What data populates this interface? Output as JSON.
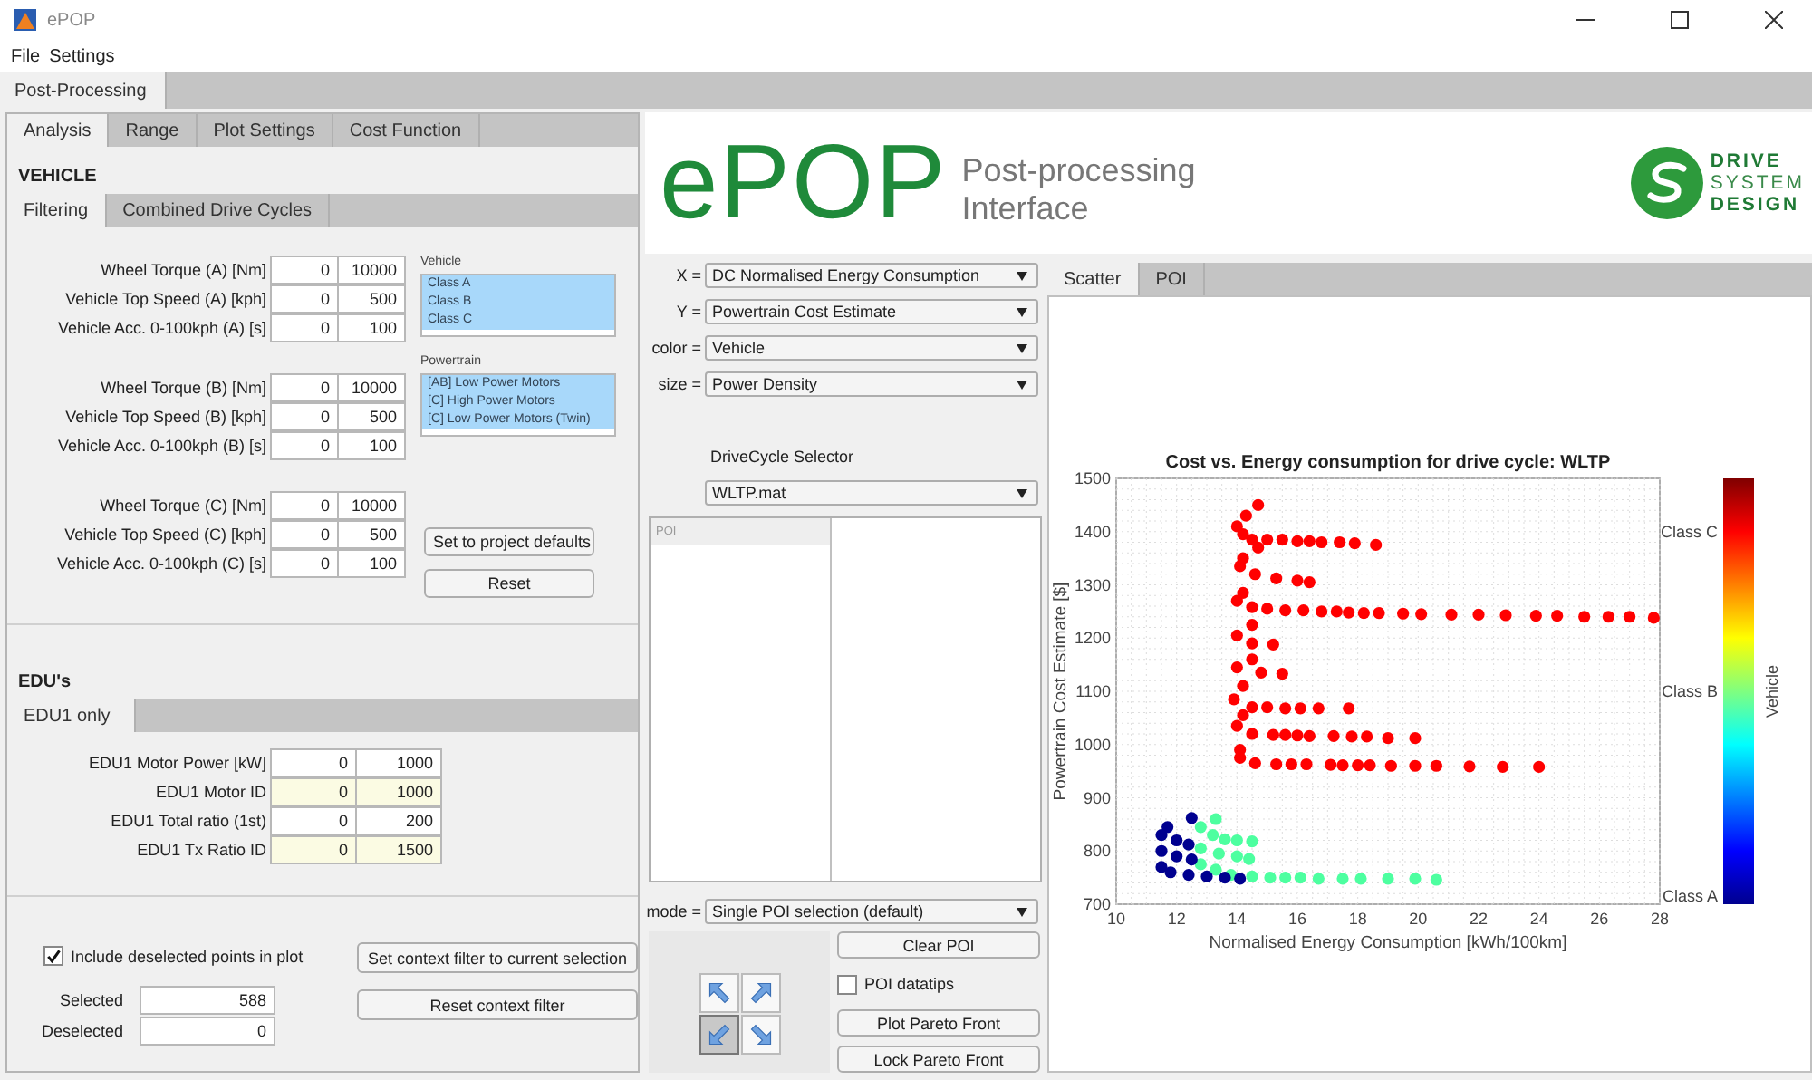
{
  "window": {
    "title": "ePOP"
  },
  "menu": [
    "File",
    "Settings"
  ],
  "main_tabs": [
    {
      "label": "Post-Processing",
      "selected": true
    }
  ],
  "left_tabs": [
    {
      "label": "Analysis",
      "selected": true
    },
    {
      "label": "Range",
      "selected": false
    },
    {
      "label": "Plot Settings",
      "selected": false
    },
    {
      "label": "Cost Function",
      "selected": false
    }
  ],
  "vehicle": {
    "heading": "VEHICLE",
    "tabs": [
      {
        "label": "Filtering",
        "selected": true
      },
      {
        "label": "Combined Drive Cycles",
        "selected": false
      }
    ],
    "filter_groups": [
      [
        {
          "label": "Wheel Torque (A) [Nm]",
          "min": "0",
          "max": "10000"
        },
        {
          "label": "Vehicle Top Speed (A) [kph]",
          "min": "0",
          "max": "500"
        },
        {
          "label": "Vehicle Acc. 0-100kph (A) [s]",
          "min": "0",
          "max": "100"
        }
      ],
      [
        {
          "label": "Wheel Torque (B) [Nm]",
          "min": "0",
          "max": "10000"
        },
        {
          "label": "Vehicle Top Speed (B) [kph]",
          "min": "0",
          "max": "500"
        },
        {
          "label": "Vehicle Acc. 0-100kph (B) [s]",
          "min": "0",
          "max": "100"
        }
      ],
      [
        {
          "label": "Wheel Torque (C) [Nm]",
          "min": "0",
          "max": "10000"
        },
        {
          "label": "Vehicle Top Speed (C) [kph]",
          "min": "0",
          "max": "500"
        },
        {
          "label": "Vehicle Acc. 0-100kph (C) [s]",
          "min": "0",
          "max": "100"
        }
      ]
    ],
    "lists": [
      {
        "label": "Vehicle",
        "items": [
          {
            "text": "Class A",
            "selected": true
          },
          {
            "text": "Class B",
            "selected": true
          },
          {
            "text": "Class C",
            "selected": true
          }
        ]
      },
      {
        "label": "Powertrain",
        "items": [
          {
            "text": "[AB] Low Power Motors",
            "selected": true
          },
          {
            "text": "[C] High Power Motors",
            "selected": true
          },
          {
            "text": "[C] Low Power Motors (Twin)",
            "selected": true
          }
        ]
      }
    ],
    "buttons": [
      "Set to project defaults",
      "Reset"
    ]
  },
  "edus": {
    "heading": "EDU's",
    "tabs": [
      {
        "label": "EDU1 only",
        "selected": true
      }
    ],
    "rows": [
      {
        "label": "EDU1 Motor Power [kW]",
        "min": "0",
        "max": "1000",
        "highlighted": false
      },
      {
        "label": "EDU1 Motor ID",
        "min": "0",
        "max": "1000",
        "highlighted": true
      },
      {
        "label": "EDU1 Total ratio (1st)",
        "min": "0",
        "max": "200",
        "highlighted": false
      },
      {
        "label": "EDU1 Tx Ratio ID",
        "min": "0",
        "max": "1500",
        "highlighted": true
      }
    ]
  },
  "selection": {
    "include_deselected": {
      "label": "Include deselected points in plot",
      "checked": true
    },
    "stats": [
      {
        "label": "Selected",
        "value": "588"
      },
      {
        "label": "Deselected",
        "value": "0"
      }
    ],
    "buttons": [
      "Set context filter to current selection",
      "Reset context filter"
    ]
  },
  "logo": {
    "name": "ePOP",
    "subtitle": [
      "Post-processing",
      "Interface"
    ],
    "brand": [
      "DRIVE",
      "SYSTEM",
      "DESIGN"
    ]
  },
  "axes_selectors": [
    {
      "label": "X =",
      "value": "DC Normalised Energy Consumption"
    },
    {
      "label": "Y =",
      "value": "Powertrain Cost Estimate"
    },
    {
      "label": "color =",
      "value": "Vehicle"
    },
    {
      "label": "size =",
      "value": "Power Density"
    }
  ],
  "drive_cycle": {
    "label": "DriveCycle Selector",
    "value": "WLTP.mat"
  },
  "poi_table": {
    "columns": [
      "POI"
    ]
  },
  "mode": {
    "label": "mode =",
    "value": "Single POI selection (default)"
  },
  "arrow_pad": [
    {
      "kind": "up-left",
      "selected": false
    },
    {
      "kind": "up-right",
      "selected": false
    },
    {
      "kind": "down-left",
      "selected": true
    },
    {
      "kind": "down-right",
      "selected": false
    }
  ],
  "poi_controls": [
    {
      "kind": "button",
      "label": "Clear POI"
    },
    {
      "kind": "checkbox",
      "label": "POI datatips",
      "checked": false
    },
    {
      "kind": "button",
      "label": "Plot Pareto Front"
    },
    {
      "kind": "button",
      "label": "Lock Pareto Front"
    }
  ],
  "plot_tabs": [
    {
      "label": "Scatter",
      "selected": true
    },
    {
      "label": "POI",
      "selected": false
    }
  ],
  "scatter": {
    "chart_data": {
      "type": "scatter",
      "title": "Cost vs. Energy consumption for drive cycle: WLTP",
      "xlabel": "Normalised Energy Consumption [kWh/100km]",
      "ylabel": "Powertrain Cost Estimate [$]",
      "grid": true,
      "xlim": [
        10,
        28
      ],
      "ylim": [
        700,
        1500
      ],
      "xticks": [
        10,
        12,
        14,
        16,
        18,
        20,
        22,
        24,
        26,
        28
      ],
      "yticks": [
        700,
        800,
        900,
        1000,
        1100,
        1200,
        1300,
        1400,
        1500
      ],
      "series": [
        {
          "color": "#ff0000",
          "x": [
            14.7,
            14.3,
            14,
            14.2,
            14.5,
            15,
            15.5,
            16,
            16.4,
            16.8,
            17.4,
            17.9,
            18.6,
            14.7,
            14.2,
            14.1,
            14.6,
            15.3,
            16,
            16.4,
            14.2,
            14,
            14.5,
            15,
            15.6,
            16.2,
            16.8,
            17.3,
            17.7,
            18.2,
            18.7,
            19.5,
            20.1,
            21.1,
            22,
            22.9,
            23.9,
            24.6,
            25.5,
            26.3,
            27,
            27.8,
            14.5,
            14,
            14.5,
            15.2,
            14.5,
            14,
            14.8,
            15.5,
            14.2,
            13.9,
            14.5,
            15,
            15.6,
            16.1,
            16.7,
            17.7,
            14.2,
            14,
            14.5,
            15.2,
            15.6,
            16,
            16.4,
            17.2,
            17.8,
            18.3,
            19,
            19.9,
            14.1,
            14.1,
            14.6,
            15.3,
            15.8,
            16.3,
            17.1,
            17.5,
            18,
            18.4,
            19.1,
            19.9,
            20.6,
            21.7,
            22.8,
            24
          ],
          "values": [
            1450,
            1430,
            1410,
            1395,
            1385,
            1385,
            1385,
            1382,
            1382,
            1380,
            1380,
            1378,
            1375,
            1370,
            1350,
            1335,
            1320,
            1312,
            1308,
            1305,
            1285,
            1270,
            1258,
            1255,
            1252,
            1252,
            1250,
            1250,
            1248,
            1247,
            1247,
            1246,
            1245,
            1244,
            1244,
            1243,
            1242,
            1242,
            1240,
            1240,
            1240,
            1238,
            1225,
            1205,
            1190,
            1188,
            1160,
            1145,
            1135,
            1133,
            1110,
            1085,
            1070,
            1070,
            1068,
            1068,
            1068,
            1068,
            1055,
            1035,
            1020,
            1018,
            1018,
            1017,
            1016,
            1016,
            1015,
            1015,
            1012,
            1012,
            990,
            975,
            965,
            963,
            963,
            963,
            962,
            961,
            961,
            961,
            960,
            960,
            960,
            959,
            958,
            958
          ]
        },
        {
          "color": "#4dffa0",
          "x": [
            13.3,
            12.8,
            13.2,
            13.6,
            14,
            14.5,
            12.8,
            13.4,
            14,
            14.4,
            12.8,
            13.3,
            13.8,
            14.5,
            15.1,
            15.6,
            16.1,
            16.7,
            17.5,
            18.1,
            19,
            19.9,
            20.6
          ],
          "values": [
            860,
            845,
            830,
            822,
            820,
            818,
            805,
            795,
            790,
            785,
            775,
            765,
            755,
            752,
            750,
            750,
            750,
            748,
            748,
            748,
            748,
            748,
            746
          ]
        },
        {
          "color": "#00008f",
          "x": [
            12.5,
            11.7,
            11.5,
            12,
            12.4,
            11.5,
            12,
            12.5,
            11.5,
            11.8,
            12.4,
            13,
            13.6,
            14.1
          ],
          "values": [
            862,
            845,
            830,
            820,
            812,
            800,
            790,
            784,
            770,
            760,
            755,
            752,
            750,
            748
          ]
        }
      ]
    },
    "colorbar": {
      "label": "Vehicle",
      "ticks": [
        "Class C",
        "Class B",
        "Class A"
      ]
    }
  }
}
